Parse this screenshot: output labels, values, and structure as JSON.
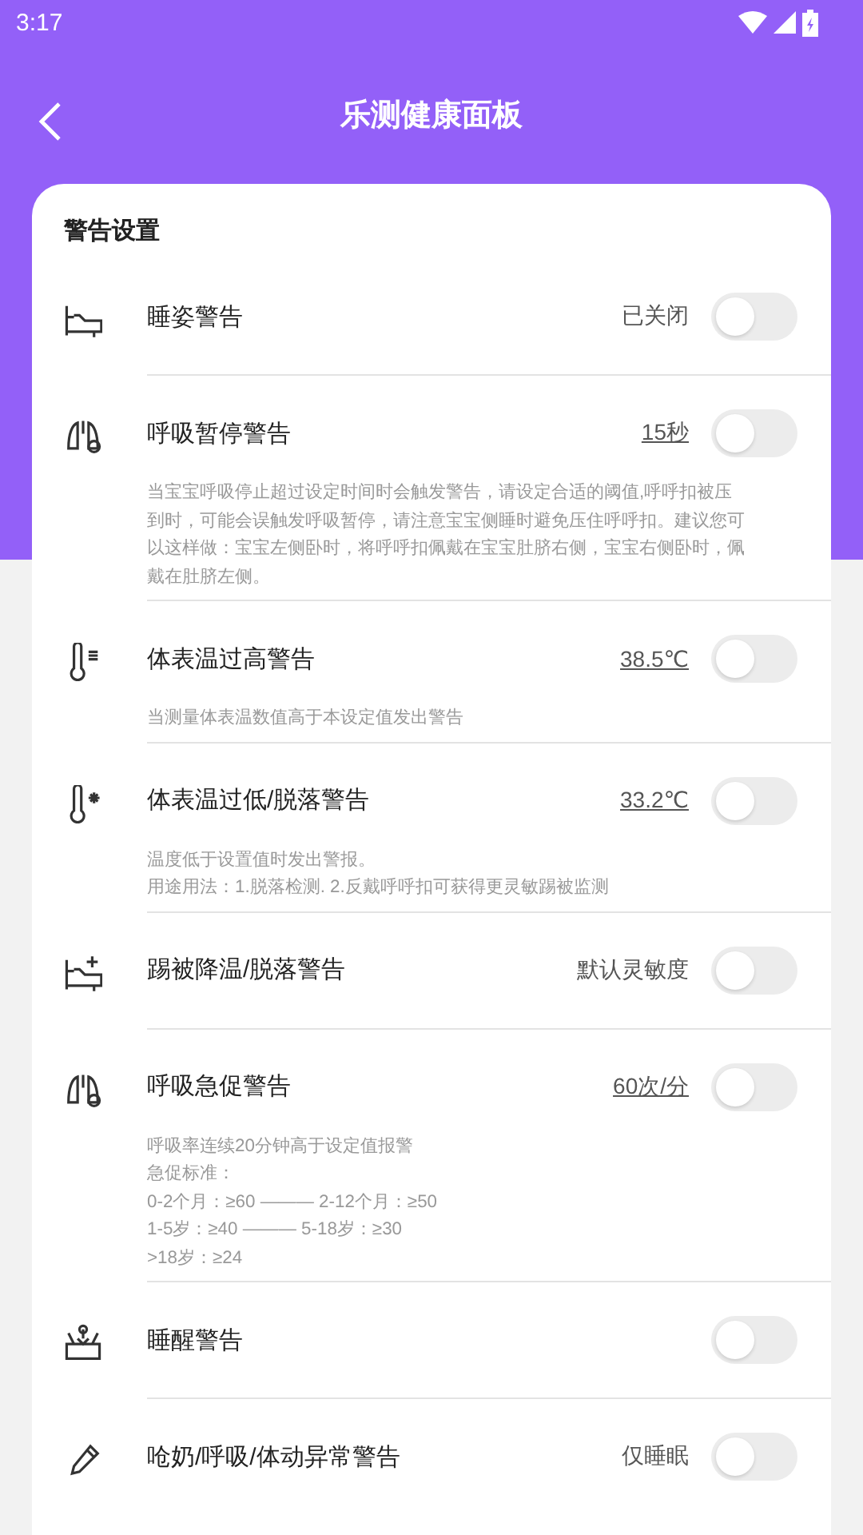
{
  "status_bar": {
    "time": "3:17"
  },
  "header": {
    "title": "乐测健康面板"
  },
  "card": {
    "title": "警告设置",
    "rows": [
      {
        "label": "睡姿警告",
        "value": "已关闭",
        "underlined": false,
        "on": false,
        "description": []
      },
      {
        "label": "呼吸暂停警告",
        "value": "15秒",
        "underlined": true,
        "on": false,
        "description": [
          "当宝宝呼吸停止超过设定时间时会触发警告，请设定合适的阈值,呼呼扣被压",
          "到时，可能会误触发呼吸暂停，请注意宝宝侧睡时避免压住呼呼扣。建议您可",
          "以这样做：宝宝左侧卧时，将呼呼扣佩戴在宝宝肚脐右侧，宝宝右侧卧时，佩",
          "戴在肚脐左侧。"
        ]
      },
      {
        "label": "体表温过高警告",
        "value": "38.5℃",
        "underlined": true,
        "on": false,
        "description": [
          "当测量体表温数值高于本设定值发出警告"
        ]
      },
      {
        "label": "体表温过低/脱落警告",
        "value": "33.2℃",
        "underlined": true,
        "on": false,
        "description": [
          "温度低于设置值时发出警报。",
          "用途用法：1.脱落检测. 2.反戴呼呼扣可获得更灵敏踢被监测"
        ]
      },
      {
        "label": "踢被降温/脱落警告",
        "value": "默认灵敏度",
        "underlined": false,
        "on": false,
        "description": []
      },
      {
        "label": "呼吸急促警告",
        "value": "60次/分",
        "underlined": true,
        "on": false,
        "description": [
          "呼吸率连续20分钟高于设定值报警",
          "急促标准：",
          "0-2个月：≥60 ——— 2-12个月：≥50",
          "1-5岁：≥40 ——— 5-18岁：≥30",
          ">18岁：≥24"
        ]
      },
      {
        "label": "睡醒警告",
        "on": false,
        "description": []
      },
      {
        "label": "呛奶/呼吸/体动异常警告",
        "value": "仅睡眠",
        "underlined": false,
        "on": false,
        "description": []
      }
    ]
  }
}
